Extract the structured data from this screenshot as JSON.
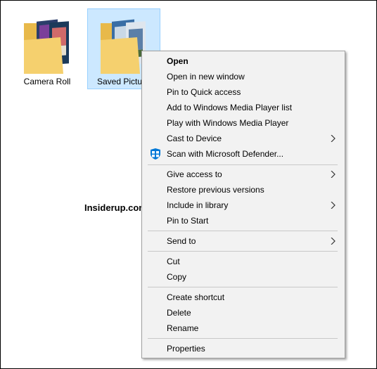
{
  "desktop": {
    "folders": [
      {
        "label": "Camera Roll"
      },
      {
        "label": "Saved Pictures"
      }
    ],
    "watermark": "Insiderup.com"
  },
  "menu": {
    "items": [
      {
        "label": "Open"
      },
      {
        "label": "Open in new window"
      },
      {
        "label": "Pin to Quick access"
      },
      {
        "label": "Add to Windows Media Player list"
      },
      {
        "label": "Play with Windows Media Player"
      },
      {
        "label": "Cast to Device"
      },
      {
        "label": "Scan with Microsoft Defender..."
      },
      {
        "label": "Give access to"
      },
      {
        "label": "Restore previous versions"
      },
      {
        "label": "Include in library"
      },
      {
        "label": "Pin to Start"
      },
      {
        "label": "Send to"
      },
      {
        "label": "Cut"
      },
      {
        "label": "Copy"
      },
      {
        "label": "Create shortcut"
      },
      {
        "label": "Delete"
      },
      {
        "label": "Rename"
      },
      {
        "label": "Properties"
      }
    ]
  },
  "icons": {
    "submenu_arrow": "chevron-right-icon",
    "defender": "shield-icon",
    "folder": "folder-icon"
  },
  "colors": {
    "selection": "#cce8ff",
    "menu_bg": "#f2f2f2",
    "defender_blue": "#0078d7"
  }
}
